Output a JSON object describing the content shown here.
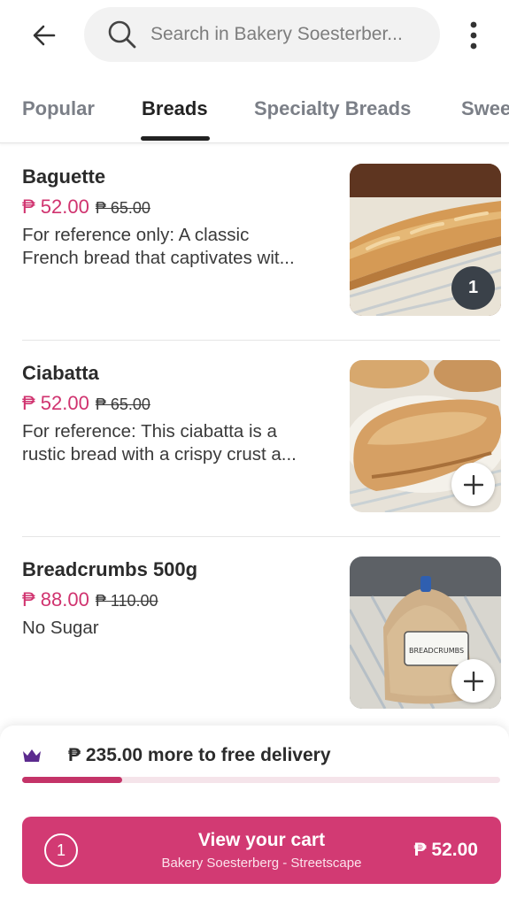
{
  "search": {
    "placeholder": "Search in Bakery Soesterber..."
  },
  "tabs": [
    {
      "label": "Popular",
      "active": false
    },
    {
      "label": "Breads",
      "active": true
    },
    {
      "label": "Specialty Breads",
      "active": false
    },
    {
      "label": "Swee",
      "active": false
    }
  ],
  "products": [
    {
      "name": "Baguette",
      "price": "₱ 52.00",
      "old_price": "₱ 65.00",
      "desc_line1": "For reference only: A classic",
      "desc_line2": "French bread that captivates wit...",
      "quantity": "1",
      "image_icon": "baguette-image"
    },
    {
      "name": "Ciabatta",
      "price": "₱ 52.00",
      "old_price": "₱ 65.00",
      "desc_line1": "For reference: This ciabatta is a",
      "desc_line2": "rustic bread with a crispy crust a...",
      "image_icon": "ciabatta-image"
    },
    {
      "name": "Breadcrumbs 500g",
      "price": "₱ 88.00",
      "old_price": "₱ 110.00",
      "desc_line1": "No Sugar",
      "image_icon": "breadcrumbs-bag-image",
      "package_label": "BREADCRUMBS"
    }
  ],
  "delivery": {
    "text": "₱ 235.00 more to free delivery",
    "progress": 0.21,
    "icon": "crown-icon"
  },
  "cart": {
    "count": "1",
    "title": "View your cart",
    "subtitle": "Bakery Soesterberg - Streetscape",
    "total": "₱ 52.00"
  },
  "colors": {
    "accent": "#d23a73",
    "price": "#d0336f",
    "crown": "#5b2a8e",
    "badge": "#3a4149"
  }
}
